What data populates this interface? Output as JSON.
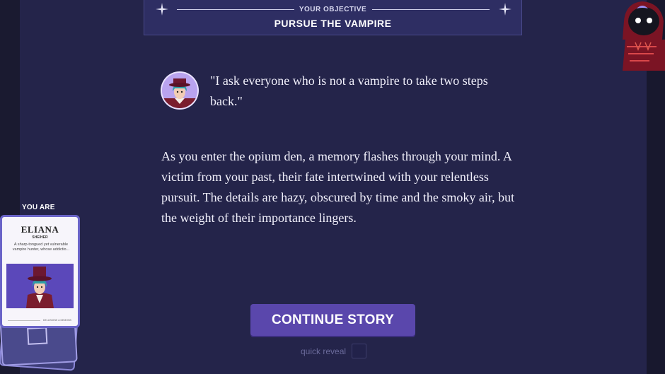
{
  "objective": {
    "label": "YOUR OBJECTIVE",
    "title": "PURSUE THE VAMPIRE"
  },
  "dialogue": {
    "quote": "\"I ask everyone who is not a vampire to take two steps back.\"",
    "narration": "As you enter the opium den, a memory flashes through your mind. A victim from your past, their fate intertwined with your relentless pursuit. The details are hazy, obscured by time and the smoky air, but the weight of their importance lingers."
  },
  "actions": {
    "continue_label": "CONTINUE STORY",
    "quick_reveal_label": "quick reveal",
    "quick_reveal_checked": false
  },
  "character": {
    "you_are_label": "YOU ARE",
    "name": "ELIANA",
    "pronouns": "SHE/HER",
    "description": "A sharp-tongued yet vulnerable vampire hunter, whose addictio...",
    "footer": "DELUSIONS & DEMONS"
  },
  "colors": {
    "background": "#24244a",
    "objective_panel": "#2e2e63",
    "button": "#5a47ac",
    "card_border": "#6a64c8",
    "text": "#f1f0fb"
  },
  "icons": [
    "sparkle-icon",
    "character-portrait",
    "hooded-figure-icon"
  ]
}
